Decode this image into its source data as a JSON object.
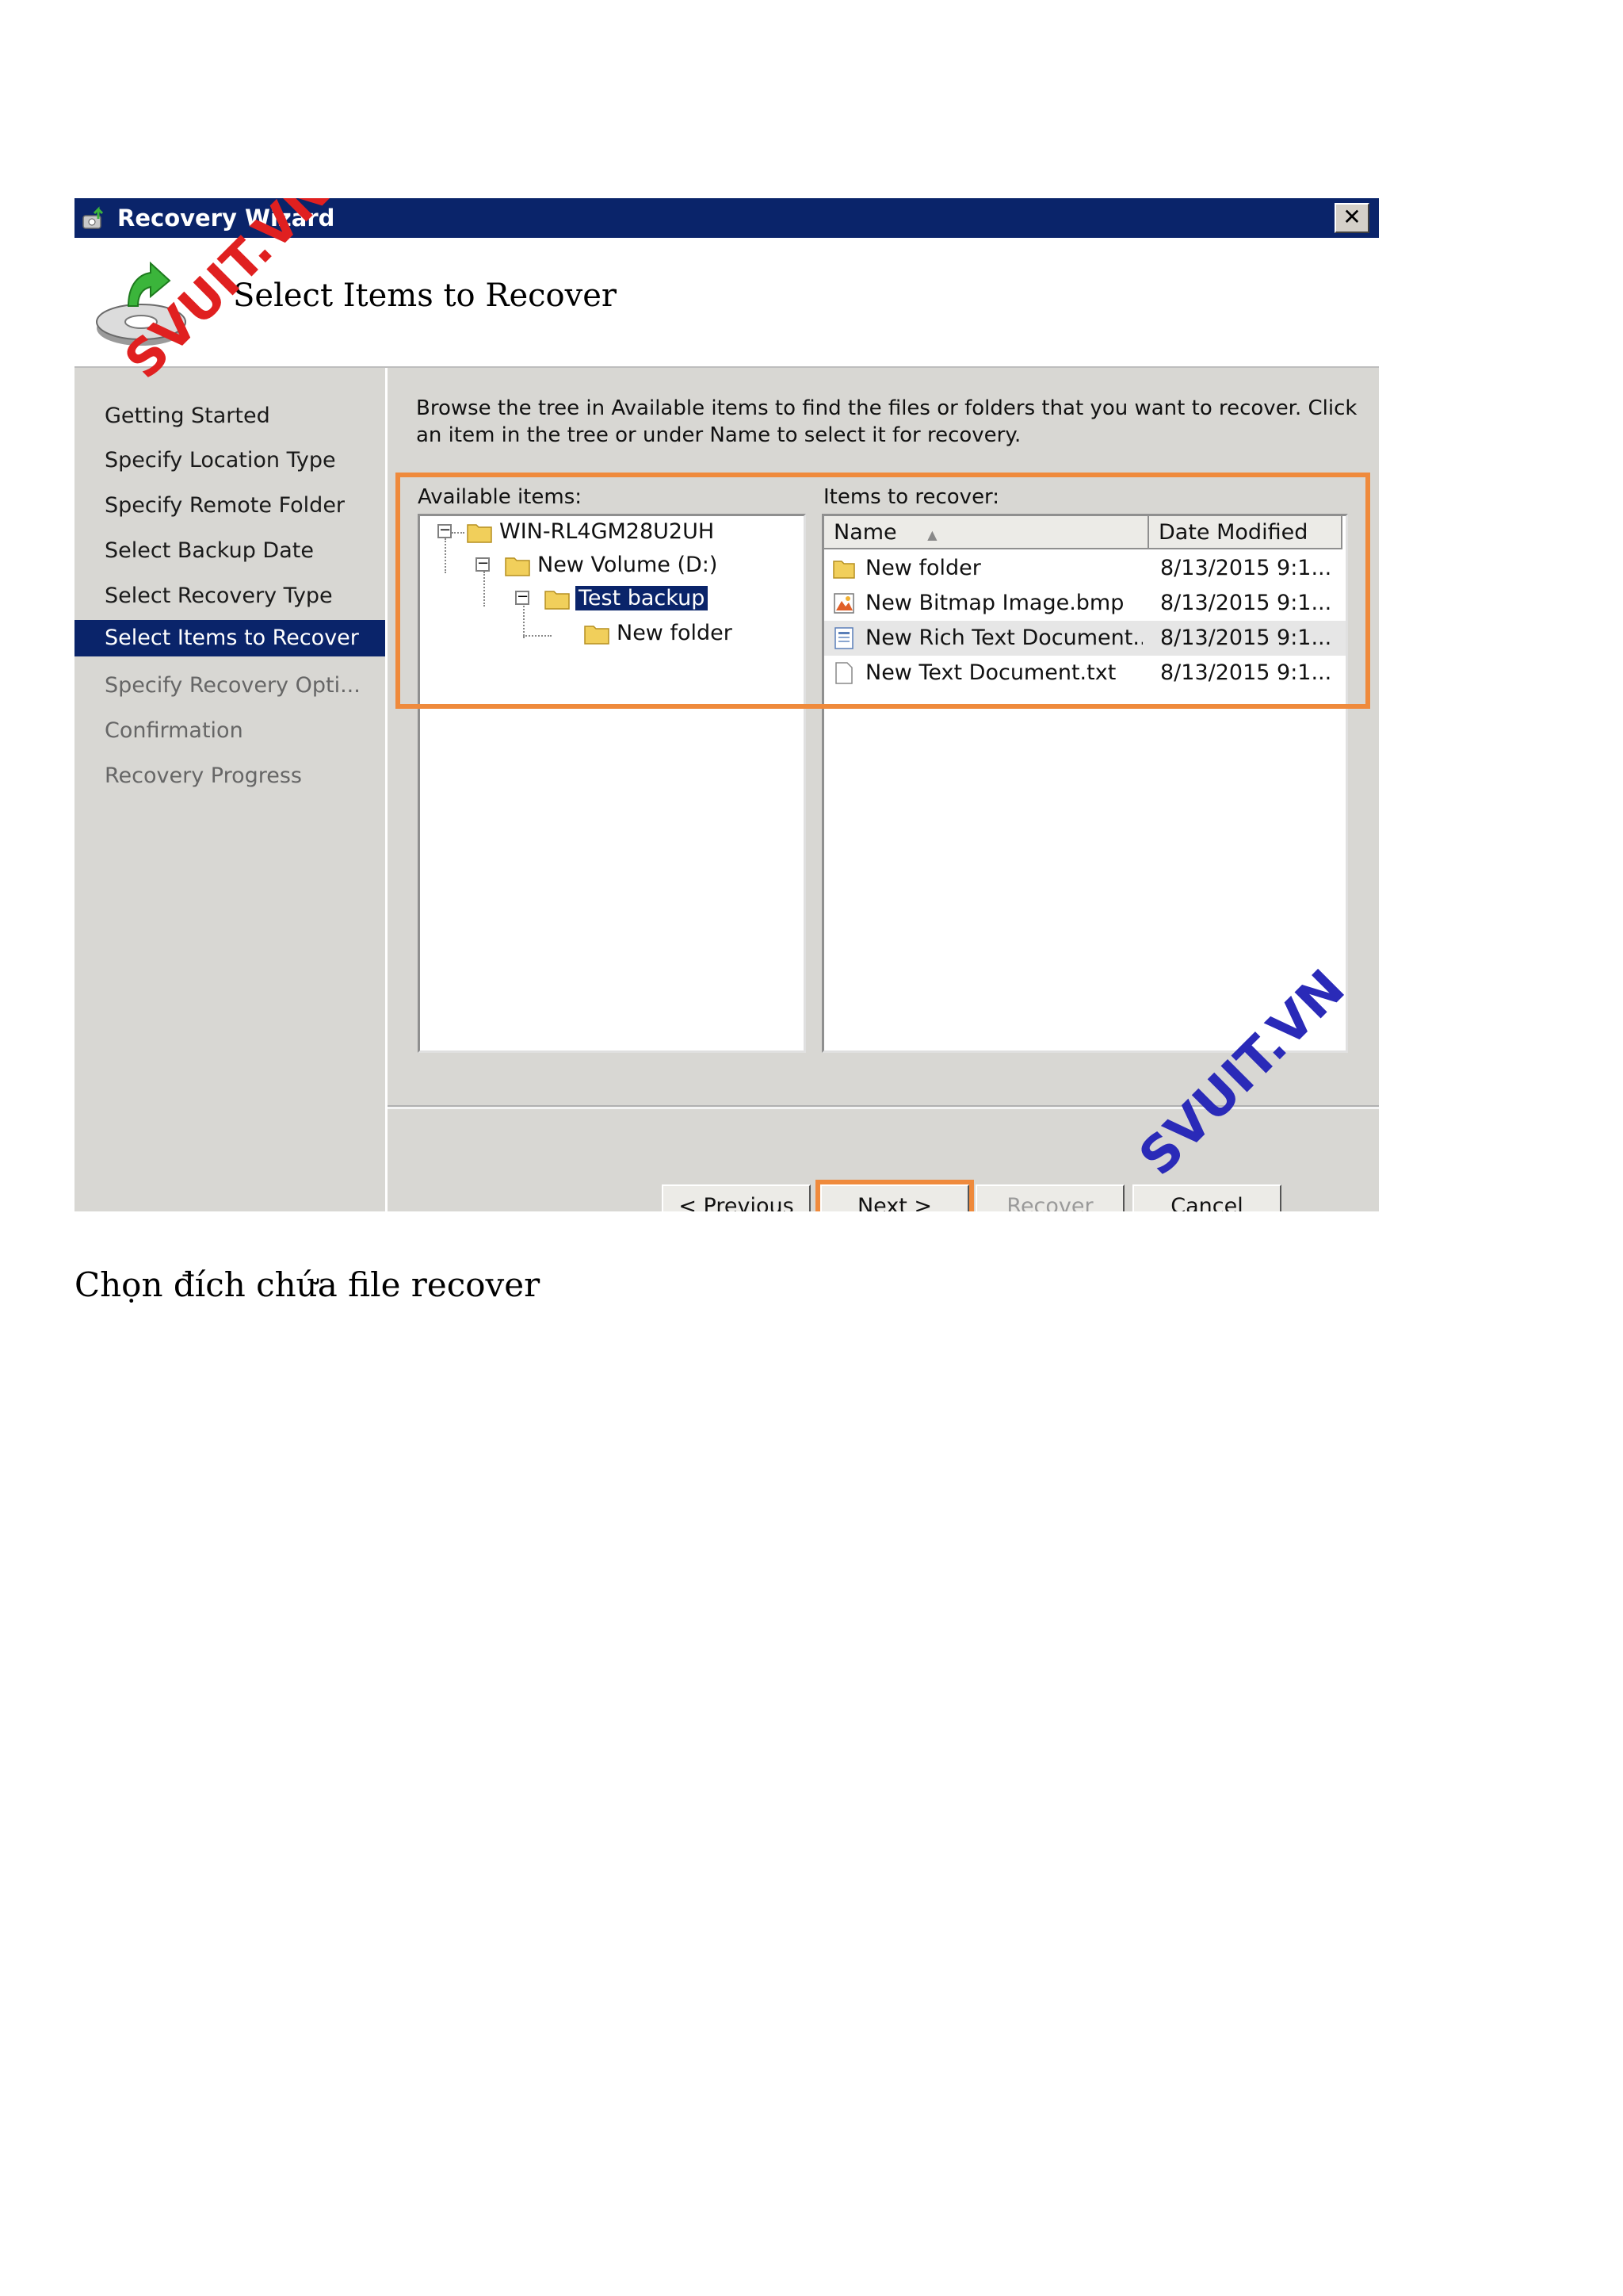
{
  "window": {
    "title": "Recovery Wizard",
    "close_glyph": "✕"
  },
  "header": {
    "title": "Select Items to Recover",
    "icon": "backup-disk-arrow-icon"
  },
  "nav": {
    "items": [
      {
        "label": "Getting Started",
        "state": "done"
      },
      {
        "label": "Specify Location Type",
        "state": "done"
      },
      {
        "label": "Specify Remote Folder",
        "state": "done"
      },
      {
        "label": "Select Backup Date",
        "state": "done"
      },
      {
        "label": "Select Recovery Type",
        "state": "done"
      },
      {
        "label": "Select Items to Recover",
        "state": "active"
      },
      {
        "label": "Specify Recovery Opti...",
        "state": "pending"
      },
      {
        "label": "Confirmation",
        "state": "pending"
      },
      {
        "label": "Recovery Progress",
        "state": "pending"
      }
    ]
  },
  "main": {
    "instructions": "Browse the tree in Available items to find the files or folders that you want to recover. Click an item in the tree or under Name to select it for recovery.",
    "available_label": "Available items:",
    "recover_label": "Items to recover:",
    "tree": [
      {
        "label": "WIN-RL4GM28U2UH",
        "toggle": "−"
      },
      {
        "label": "New Volume (D:)",
        "toggle": "−"
      },
      {
        "label": "Test backup",
        "toggle": "−",
        "selected": true
      },
      {
        "label": "New folder"
      }
    ],
    "columns": {
      "name": "Name",
      "date": "Date Modified",
      "sort_glyph": "▲"
    },
    "files": [
      {
        "name": "New folder",
        "date": "8/13/2015 9:1...",
        "icon": "folder-icon"
      },
      {
        "name": "New Bitmap Image.bmp",
        "date": "8/13/2015 9:1...",
        "icon": "bitmap-file-icon"
      },
      {
        "name": "New Rich Text Document...",
        "date": "8/13/2015 9:1...",
        "icon": "rich-text-file-icon"
      },
      {
        "name": "New Text Document.txt",
        "date": "8/13/2015 9:1...",
        "icon": "text-file-icon"
      }
    ]
  },
  "buttons": {
    "previous": "< Previous",
    "next": "Next >",
    "recover": "Recover",
    "cancel": "Cancel"
  },
  "watermark": "SVUIT.VN",
  "caption": "Chọn đích chứa file recover",
  "colors": {
    "title_bar": "#0a246a",
    "highlight": "#ef8a3c",
    "watermark_red": "#e02020",
    "watermark_blue": "#2a2ab8"
  }
}
